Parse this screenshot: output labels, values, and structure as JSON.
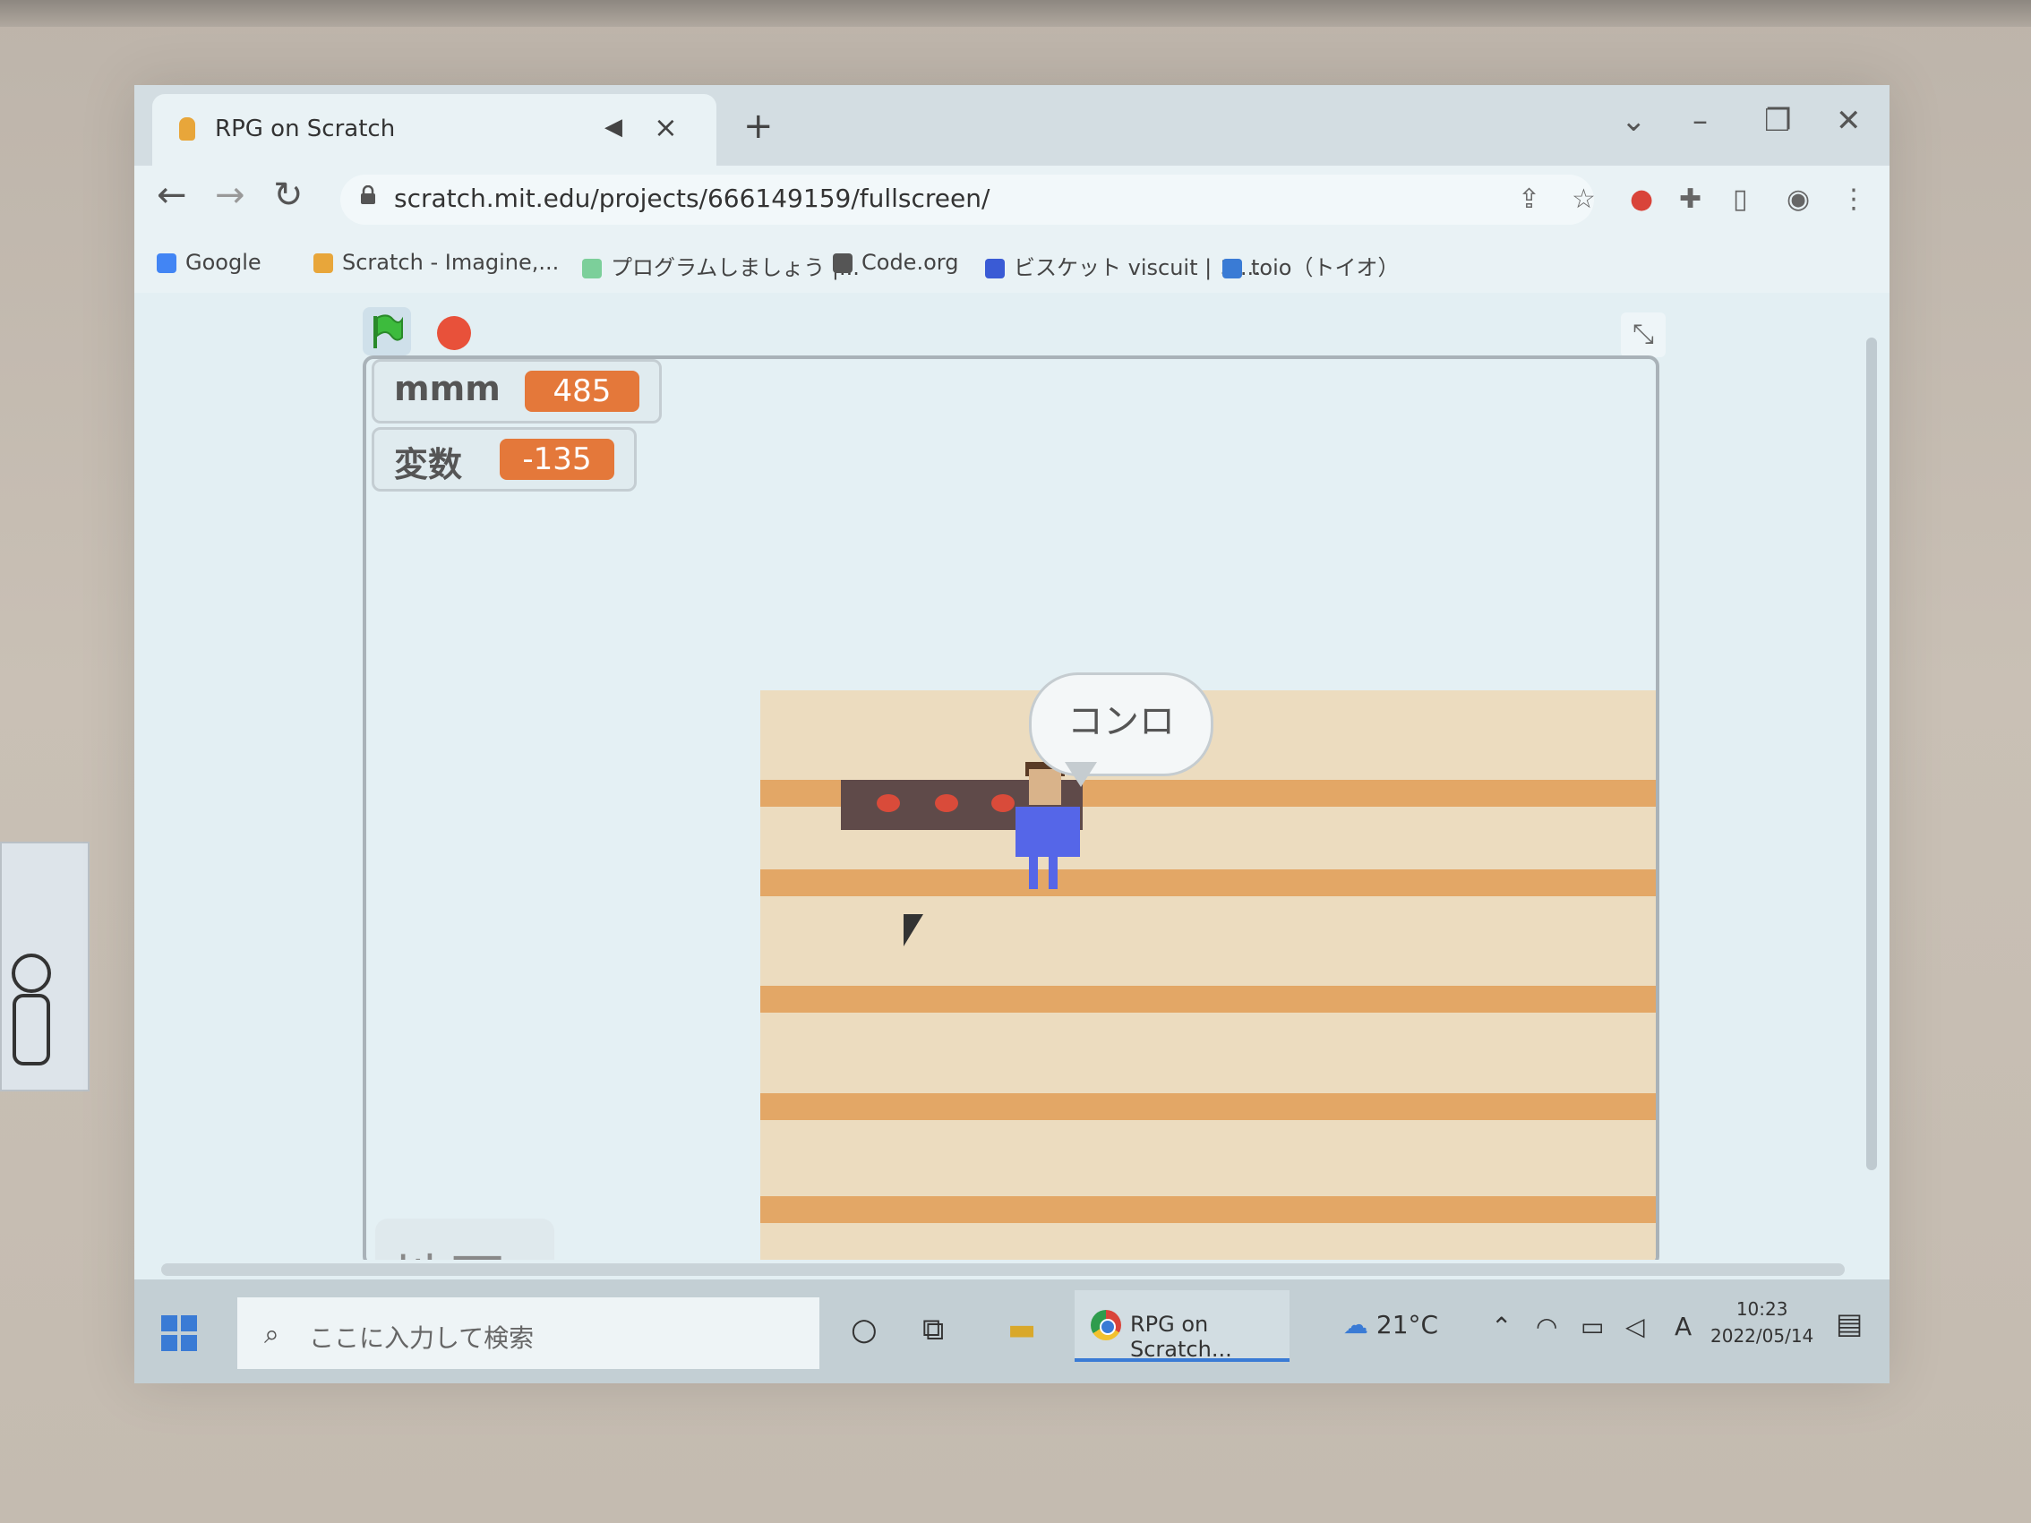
{
  "browser": {
    "tab_title": "RPG on Scratch",
    "url": "scratch.mit.edu/projects/666149159/fullscreen/",
    "new_tab": "+",
    "bookmarks": [
      {
        "label": "Google",
        "color": "#4285f4"
      },
      {
        "label": "Scratch - Imagine,...",
        "color": "#e8a63a"
      },
      {
        "label": "プログラムしましょう |...",
        "color": "#7ccf9a"
      },
      {
        "label": "Code.org",
        "color": "#555555"
      },
      {
        "label": "ビスケット viscuit | コ...",
        "color": "#3a5bd5"
      },
      {
        "label": "toio（トイオ）",
        "color": "#3a7bd5"
      }
    ]
  },
  "monitors": [
    {
      "label": "mmm",
      "value": "485"
    },
    {
      "label": "変数",
      "value": "-135"
    }
  ],
  "map_label": "地図",
  "speech_bubble": "コンロ",
  "taskbar": {
    "search_placeholder": "ここに入力して検索",
    "chrome_label": "RPG on Scratch...",
    "weather": "21°C",
    "ime": "A",
    "time": "10:23",
    "date": "2022/05/14"
  },
  "colors": {
    "accent": "#e4783a",
    "floor": "#ecdcbf",
    "floor_stripe": "#e3a766",
    "stop": "#e8513a",
    "flag": "#3dbb3d"
  }
}
